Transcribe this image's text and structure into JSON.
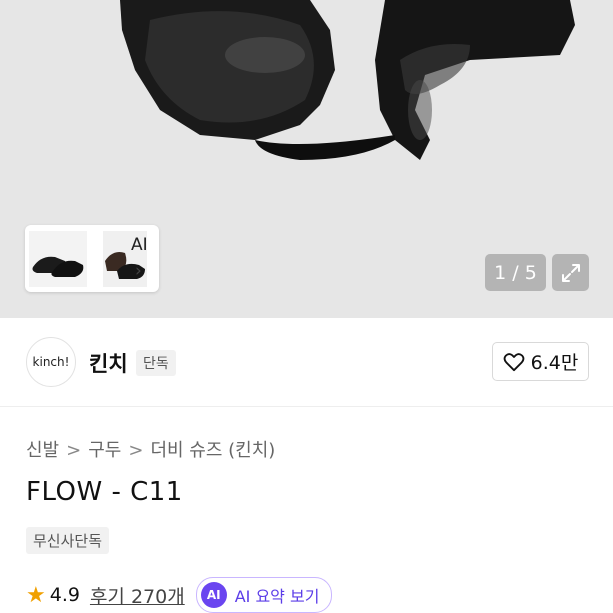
{
  "gallery": {
    "ai_label": "AI",
    "ai_chevron": "›",
    "counter": "1 / 5",
    "expand_icon": "expand-icon"
  },
  "brand": {
    "logo_text": "kinch!",
    "name": "킨치",
    "badge": "단독",
    "like_count": "6.4만",
    "like_icon": "heart-outline-icon"
  },
  "breadcrumb": [
    "신발",
    "구두",
    "더비 슈즈 (킨치)"
  ],
  "breadcrumb_separator": ">",
  "product": {
    "title": "FLOW - C11",
    "tag": "무신사단독"
  },
  "rating": {
    "star_icon": "star-icon",
    "value": "4.9",
    "reviews": "후기 270개",
    "ai_badge": "AI",
    "ai_summary": "AI 요약 보기",
    "star_color": "#f0a000",
    "accent_color": "#6a45f0"
  }
}
